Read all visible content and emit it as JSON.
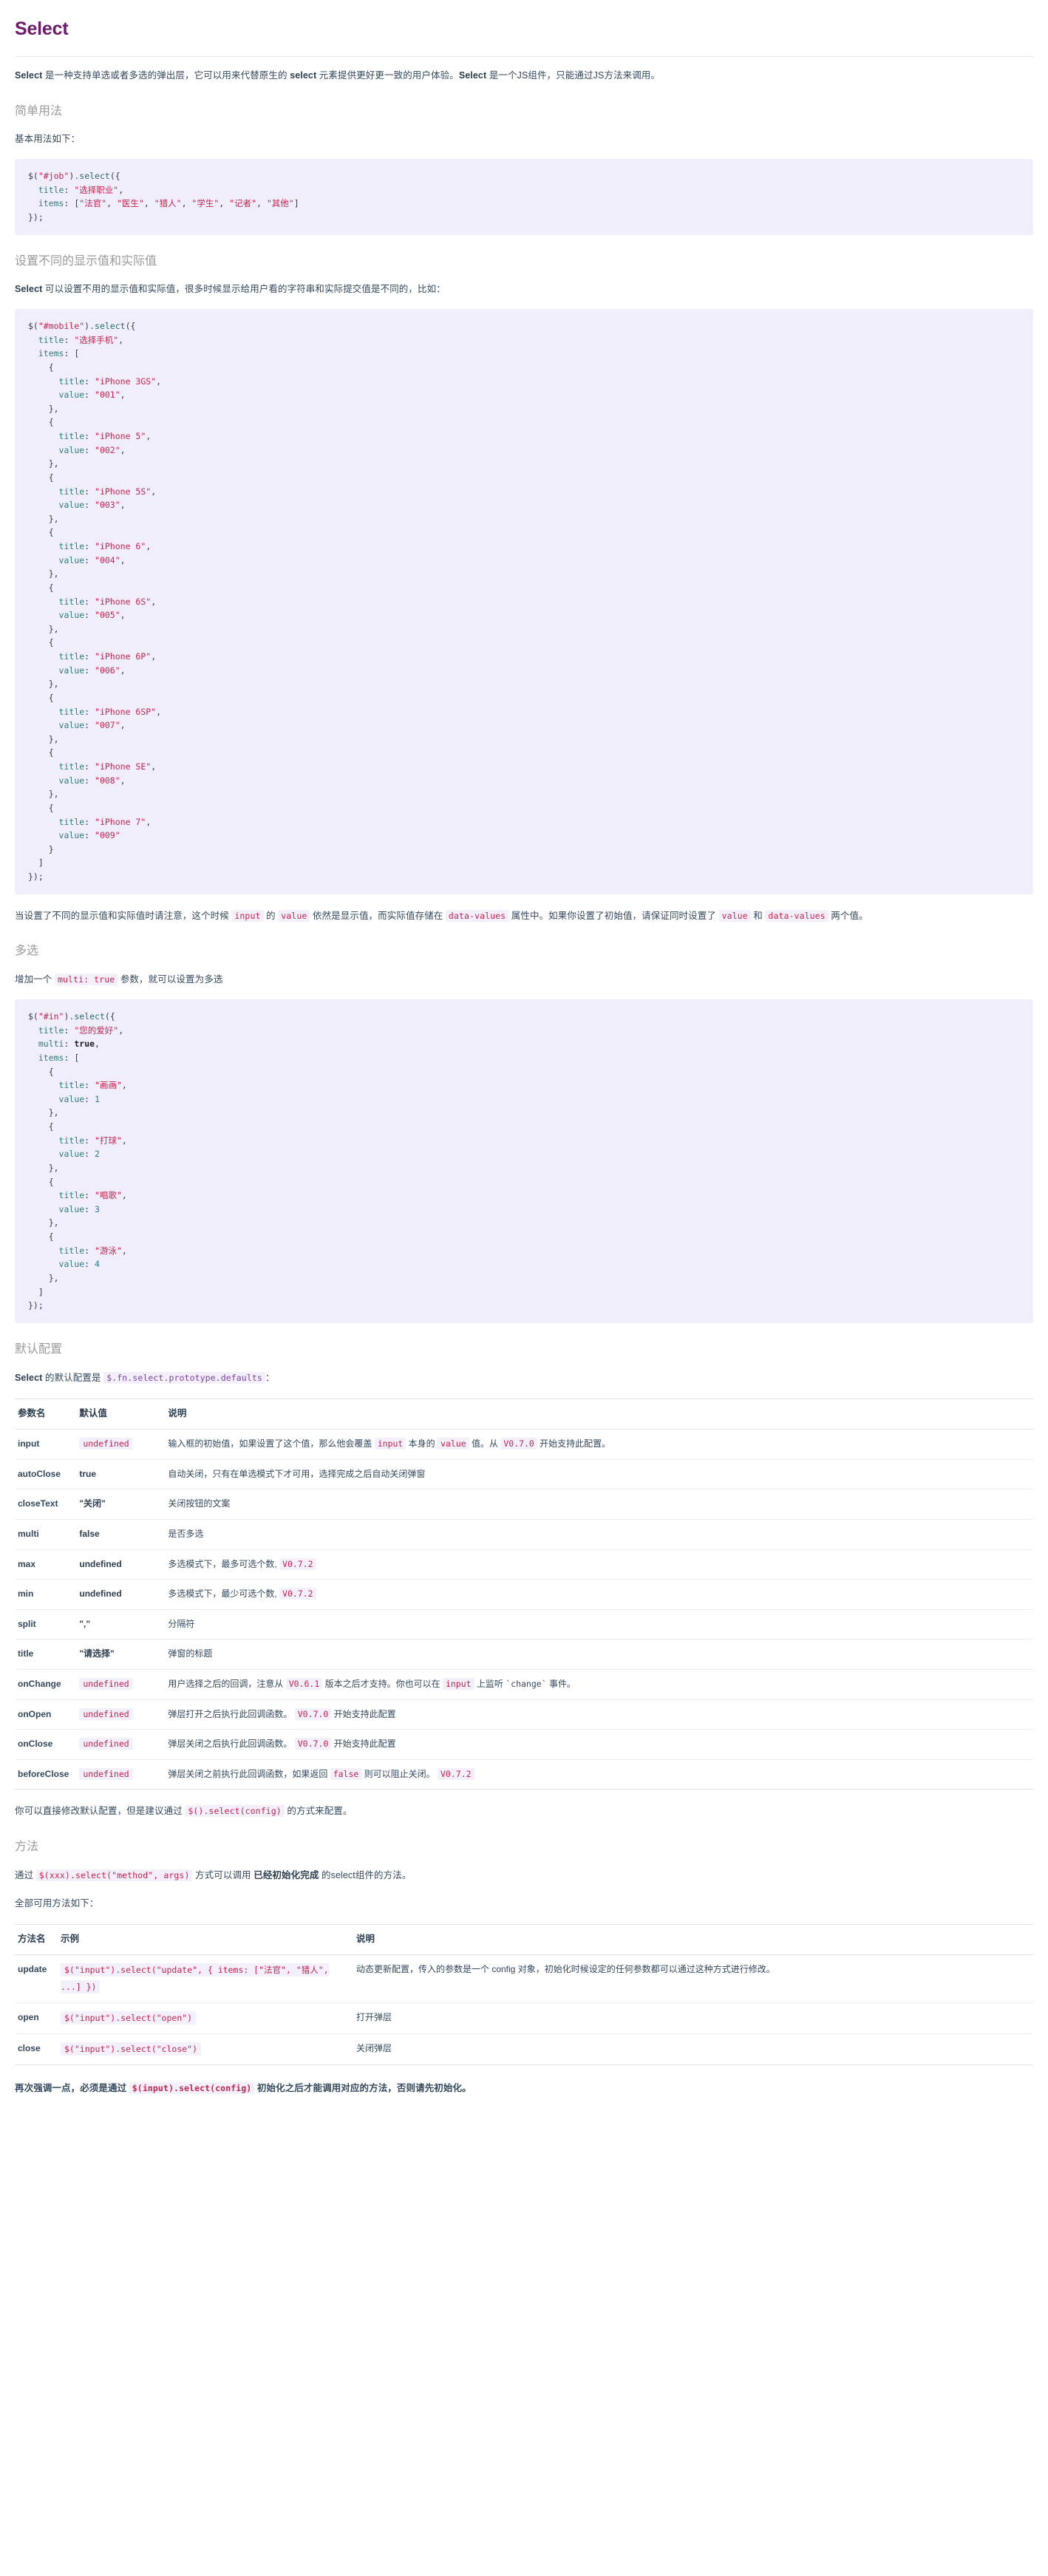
{
  "doc": {
    "title": "Select",
    "intro_prefix": "Select",
    "intro_mid": " 是一种支持单选或者多选的弹出层，它可以用来代替原生的 ",
    "intro_code": "select",
    "intro_mid2": " 元素提供更好更一致的用户体验。",
    "intro_strong2": "Select",
    "intro_tail": " 是一个JS组件，只能通过JS方法来调用。"
  },
  "sections": {
    "simple": {
      "heading": "简单用法",
      "lead": "基本用法如下：",
      "code": "$(\"#job\").select({\n  title: \"选择职业\",\n  items: [\"法官\", \"医生\", \"猎人\", \"学生\", \"记者\", \"其他\"]\n});"
    },
    "display_value": {
      "heading": "设置不同的显示值和实际值",
      "lead_strong": "Select",
      "lead_rest": " 可以设置不用的显示值和实际值，很多时候显示给用户看的字符串和实际提交值是不同的，比如：",
      "code": "$(\"#mobile\").select({\n  title: \"选择手机\",\n  items: [\n    {\n      title: \"iPhone 3GS\",\n      value: \"001\",\n    },\n    {\n      title: \"iPhone 5\",\n      value: \"002\",\n    },\n    {\n      title: \"iPhone 5S\",\n      value: \"003\",\n    },\n    {\n      title: \"iPhone 6\",\n      value: \"004\",\n    },\n    {\n      title: \"iPhone 6S\",\n      value: \"005\",\n    },\n    {\n      title: \"iPhone 6P\",\n      value: \"006\",\n    },\n    {\n      title: \"iPhone 6SP\",\n      value: \"007\",\n    },\n    {\n      title: \"iPhone SE\",\n      value: \"008\",\n    },\n    {\n      title: \"iPhone 7\",\n      value: \"009\"\n    }\n  ]\n});",
      "note_p1": "当设置了不同的显示值和实际值时请注意，这个时候 ",
      "note_c1": "input",
      "note_p2": " 的 ",
      "note_c2": "value",
      "note_p3": " 依然是显示值，而实际值存储在 ",
      "note_c3": "data-values",
      "note_p4": " 属性中。如果你设置了初始值，请保证同时设置了 ",
      "note_c4": "value",
      "note_p5": " 和 ",
      "note_c5": "data-values",
      "note_p6": " 两个值。"
    },
    "multi": {
      "heading": "多选",
      "lead_p1": "增加一个 ",
      "lead_code": "multi: true",
      "lead_p2": " 参数，就可以设置为多选",
      "code": "$(\"#in\").select({\n  title: \"您的爱好\",\n  multi: true,\n  items: [\n    {\n      title: \"画画\",\n      value: 1\n    },\n    {\n      title: \"打球\",\n      value: 2\n    },\n    {\n      title: \"唱歌\",\n      value: 3\n    },\n    {\n      title: \"游泳\",\n      value: 4\n    },\n  ]\n});"
    },
    "defaults": {
      "heading": "默认配置",
      "lead_strong": "Select",
      "lead_mid": " 的默认配置是 ",
      "lead_code": "$.fn.select.prototype.defaults",
      "lead_tail": "：",
      "columns": [
        "参数名",
        "默认值",
        "说明"
      ],
      "rows": [
        {
          "name": "input",
          "default": "undefined",
          "default_type": "code",
          "desc_parts": [
            {
              "t": "text",
              "v": "输入框的初始值，如果设置了这个值，那么他会覆盖 "
            },
            {
              "t": "code",
              "v": "input"
            },
            {
              "t": "text",
              "v": " 本身的 "
            },
            {
              "t": "code",
              "v": "value"
            },
            {
              "t": "text",
              "v": " 值。从 "
            },
            {
              "t": "code",
              "v": "V0.7.0"
            },
            {
              "t": "text",
              "v": " 开始支持此配置。"
            }
          ]
        },
        {
          "name": "autoClose",
          "default": "true",
          "default_type": "plain",
          "desc_parts": [
            {
              "t": "text",
              "v": "自动关闭，只有在单选模式下才可用，选择完成之后自动关闭弹窗"
            }
          ]
        },
        {
          "name": "closeText",
          "default": "\"关闭\"",
          "default_type": "plain",
          "desc_parts": [
            {
              "t": "text",
              "v": "关闭按钮的文案"
            }
          ]
        },
        {
          "name": "multi",
          "default": "false",
          "default_type": "plain",
          "desc_parts": [
            {
              "t": "text",
              "v": "是否多选"
            }
          ]
        },
        {
          "name": "max",
          "default": "undefined",
          "default_type": "plain",
          "desc_parts": [
            {
              "t": "text",
              "v": "多选模式下，最多可选个数, "
            },
            {
              "t": "code",
              "v": "V0.7.2"
            }
          ]
        },
        {
          "name": "min",
          "default": "undefined",
          "default_type": "plain",
          "desc_parts": [
            {
              "t": "text",
              "v": "多选模式下，最少可选个数, "
            },
            {
              "t": "code",
              "v": "V0.7.2"
            }
          ]
        },
        {
          "name": "split",
          "default": "\",\"",
          "default_type": "plain",
          "desc_parts": [
            {
              "t": "text",
              "v": "分隔符"
            }
          ]
        },
        {
          "name": "title",
          "default": "\"请选择\"",
          "default_type": "plain",
          "desc_parts": [
            {
              "t": "text",
              "v": "弹窗的标题"
            }
          ]
        },
        {
          "name": "onChange",
          "default": "undefined",
          "default_type": "code",
          "desc_parts": [
            {
              "t": "text",
              "v": "用户选择之后的回调，注意从 "
            },
            {
              "t": "code",
              "v": "V0.6.1"
            },
            {
              "t": "text",
              "v": " 版本之后才支持。你也可以在 "
            },
            {
              "t": "code",
              "v": "input"
            },
            {
              "t": "text",
              "v": " 上监听 "
            },
            {
              "t": "tick",
              "v": "`change`"
            },
            {
              "t": "text",
              "v": " 事件。"
            }
          ]
        },
        {
          "name": "onOpen",
          "default": "undefined",
          "default_type": "code",
          "desc_parts": [
            {
              "t": "text",
              "v": "弹层打开之后执行此回调函数。 "
            },
            {
              "t": "code",
              "v": "V0.7.0"
            },
            {
              "t": "text",
              "v": " 开始支持此配置"
            }
          ]
        },
        {
          "name": "onClose",
          "default": "undefined",
          "default_type": "code",
          "desc_parts": [
            {
              "t": "text",
              "v": "弹层关闭之后执行此回调函数。 "
            },
            {
              "t": "code",
              "v": "V0.7.0"
            },
            {
              "t": "text",
              "v": " 开始支持此配置"
            }
          ]
        },
        {
          "name": "beforeClose",
          "default": "undefined",
          "default_type": "code",
          "desc_parts": [
            {
              "t": "text",
              "v": "弹层关闭之前执行此回调函数，如果返回 "
            },
            {
              "t": "code",
              "v": "false"
            },
            {
              "t": "text",
              "v": " 则可以阻止关闭。 "
            },
            {
              "t": "code",
              "v": "V0.7.2"
            }
          ]
        }
      ],
      "after_p1": "你可以直接修改默认配置，但是建议通过 ",
      "after_code": "$().select(config)",
      "after_p2": " 的方式来配置。"
    },
    "methods": {
      "heading": "方法",
      "lead_p1": "通过 ",
      "lead_code": "$(xxx).select(\"method\", args)",
      "lead_p2": " 方式可以调用 ",
      "lead_strong": "已经初始化完成",
      "lead_p3": " 的select组件的方法。",
      "lead2": "全部可用方法如下：",
      "columns": [
        "方法名",
        "示例",
        "说明"
      ],
      "rows": [
        {
          "name": "update",
          "example": "$(\"input\").select(\"update\", { items: [\"法官\", \"猎人\", ...] })",
          "desc": "动态更新配置，传入的参数是一个 config 对象，初始化时候设定的任何参数都可以通过这种方式进行修改。"
        },
        {
          "name": "open",
          "example": "$(\"input\").select(\"open\")",
          "desc": "打开弹层"
        },
        {
          "name": "close",
          "example": "$(\"input\").select(\"close\")",
          "desc": "关闭弹层"
        }
      ],
      "footer_p1": "再次强调一点，必须是通过 ",
      "footer_code": "$(input).select(config)",
      "footer_p2": " 初始化之后才能调用对应的方法，否则请先初始化。"
    }
  },
  "colors": {
    "title": "#6a1b6a",
    "code_bg": "#f0eefb",
    "inline_code": "#c7254e",
    "heading_gray": "#9a9a9a"
  }
}
